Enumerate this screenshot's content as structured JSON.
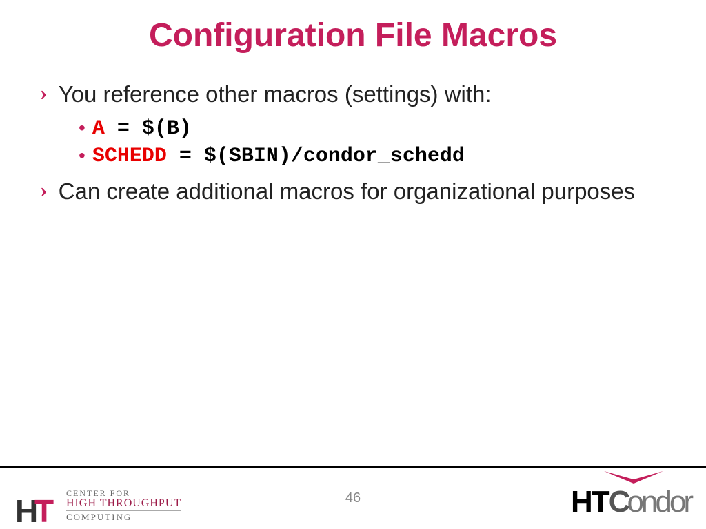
{
  "title": "Configuration File Macros",
  "bullets": {
    "b1": "You reference other macros (settings) with:",
    "sub1_kw": "A",
    "sub1_rest": " = $(B)",
    "sub2_kw": "SCHEDD",
    "sub2_rest": " = $(SBIN)/condor_schedd",
    "b2": "Can create additional macros for organizational purposes"
  },
  "footer": {
    "page": "46",
    "left_logo": {
      "line1": "CENTER FOR",
      "line2": "HIGH THROUGHPUT",
      "line3": "COMPUTING"
    },
    "right_logo": {
      "htc": "HTC",
      "ondor": "ondor"
    }
  }
}
